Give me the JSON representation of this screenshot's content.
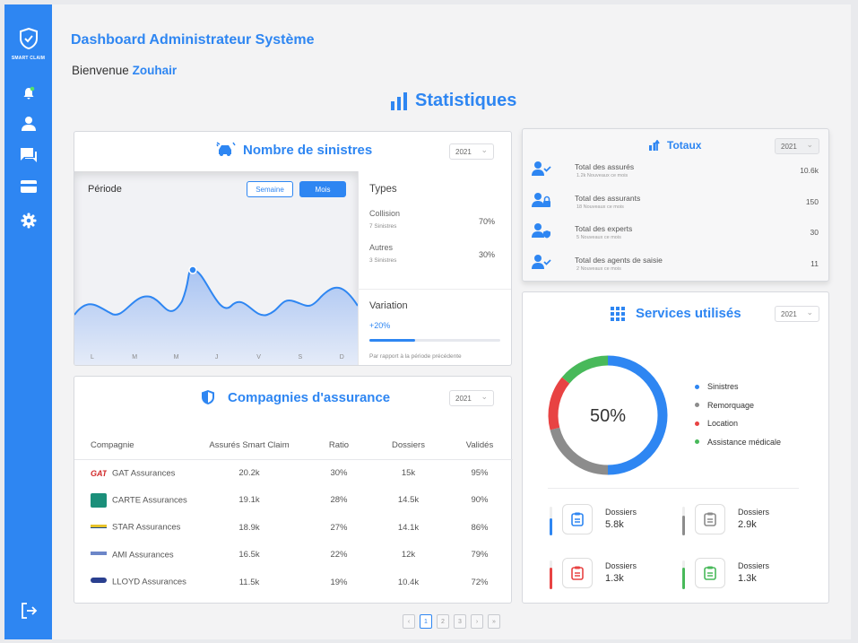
{
  "brand": {
    "name": "SMART CLAIM"
  },
  "header": {
    "title": "Dashboard Administrateur Système",
    "welcome_prefix": "Bienvenue",
    "welcome_name": "Zouhair",
    "stats_title": "Statistiques"
  },
  "sidebar": {
    "items": [
      {
        "icon": "bell-icon"
      },
      {
        "icon": "user-icon"
      },
      {
        "icon": "chat-icon"
      },
      {
        "icon": "card-icon"
      },
      {
        "icon": "gear-icon"
      }
    ],
    "logout_icon": "logout-icon"
  },
  "sinistres": {
    "title": "Nombre de sinistres",
    "year": "2021",
    "period_label": "Période",
    "btn_week": "Semaine",
    "btn_month": "Mois",
    "types_title": "Types",
    "types": [
      {
        "name": "Collision",
        "count": "7 Sinistres",
        "pct": "70%"
      },
      {
        "name": "Autres",
        "count": "3 Sinistres",
        "pct": "30%"
      }
    ],
    "variation_title": "Variation",
    "variation_value": "+20%",
    "variation_fraction": 0.35,
    "variation_note": "Par rapport à la période précédente",
    "days": [
      "L",
      "M",
      "M",
      "J",
      "V",
      "S",
      "D"
    ]
  },
  "totaux": {
    "title": "Totaux",
    "year": "2021",
    "rows": [
      {
        "label": "Total des assurés",
        "sub": "1.2k Nouveaux ce mois",
        "value": "10.6k",
        "icon": "user-check-icon"
      },
      {
        "label": "Total des assurants",
        "sub": "18 Nouveaux ce mois",
        "value": "150",
        "icon": "user-lock-icon"
      },
      {
        "label": "Total des experts",
        "sub": "5  Nouveaux ce mois",
        "value": "30",
        "icon": "user-shield-icon"
      },
      {
        "label": "Total des agents de saisie",
        "sub": "2 Nouveaux ce mois",
        "value": "11",
        "icon": "user-check-icon"
      }
    ]
  },
  "compagnies": {
    "title": "Compagnies d'assurance",
    "year": "2021",
    "headers": [
      "Compagnie",
      "Assurés Smart Claim",
      "Ratio",
      "Dossiers",
      "Validés"
    ],
    "rows": [
      {
        "name": "GAT Assurances",
        "assures": "20.2k",
        "ratio": "30%",
        "dossiers": "15k",
        "valides": "95%"
      },
      {
        "name": "CARTE Assurances",
        "assures": "19.1k",
        "ratio": "28%",
        "dossiers": "14.5k",
        "valides": "90%"
      },
      {
        "name": "STAR Assurances",
        "assures": "18.9k",
        "ratio": "27%",
        "dossiers": "14.1k",
        "valides": "86%"
      },
      {
        "name": "AMI Assurances",
        "assures": "16.5k",
        "ratio": "22%",
        "dossiers": "12k",
        "valides": "79%"
      },
      {
        "name": "LLOYD Assurances",
        "assures": "11.5k",
        "ratio": "19%",
        "dossiers": "10.4k",
        "valides": "72%"
      }
    ]
  },
  "services": {
    "title": "Services utilisés",
    "year": "2021",
    "center": "50%",
    "legend": [
      {
        "label": "Sinistres",
        "color": "#2e86f2"
      },
      {
        "label": "Remorquage",
        "color": "#8c8c8c"
      },
      {
        "label": "Location",
        "color": "#e84343"
      },
      {
        "label": "Assistance médicale",
        "color": "#48b95a"
      }
    ],
    "boxes": [
      {
        "label": "Dossiers",
        "value": "5.8k",
        "color": "#2e86f2",
        "fill": 0.6
      },
      {
        "label": "Dossiers",
        "value": "2.9k",
        "color": "#8c8c8c",
        "fill": 0.7
      },
      {
        "label": "Dossiers",
        "value": "1.3k",
        "color": "#e84343",
        "fill": 0.75
      },
      {
        "label": "Dossiers",
        "value": "1.3k",
        "color": "#48b95a",
        "fill": 0.75
      }
    ]
  },
  "pagination": {
    "pages": [
      "1",
      "2",
      "3"
    ],
    "prev": "‹",
    "next": "›",
    "last": "»"
  }
}
